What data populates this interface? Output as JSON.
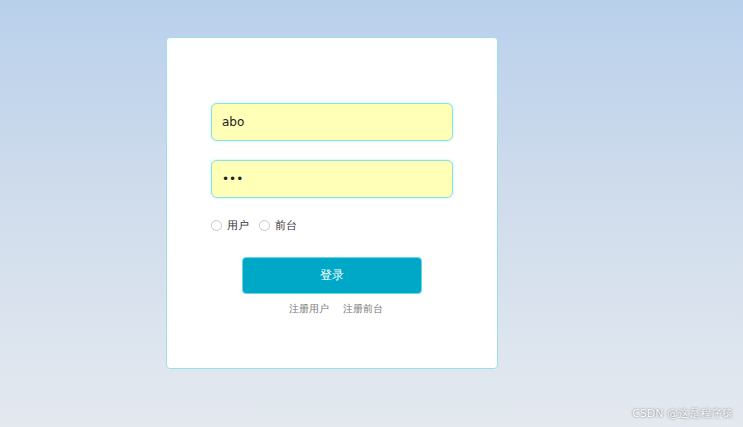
{
  "form": {
    "username": {
      "value": "abo"
    },
    "password": {
      "value": "•••"
    }
  },
  "roles": [
    {
      "label": "用户",
      "selected": false
    },
    {
      "label": "前台",
      "selected": false
    }
  ],
  "login_button": "登录",
  "links": [
    "注册用户",
    "注册前台"
  ],
  "watermark": "CSDN @这是程序猿"
}
